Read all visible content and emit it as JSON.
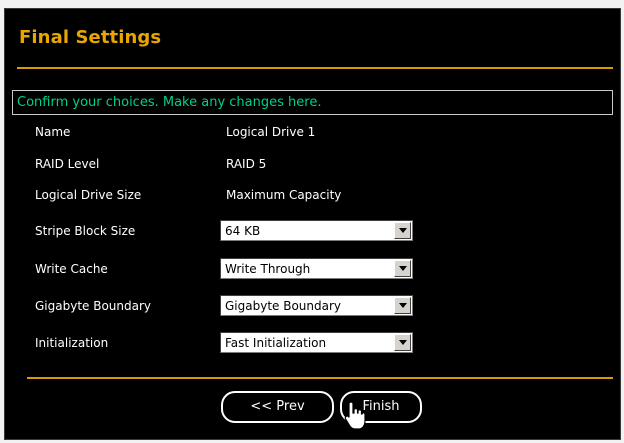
{
  "header": {
    "title": "Final Settings"
  },
  "confirm_message": "Confirm your choices. Make any changes here.",
  "fields": {
    "name": {
      "label": "Name",
      "value": "Logical Drive 1"
    },
    "raid_level": {
      "label": "RAID Level",
      "value": "RAID 5"
    },
    "drive_size": {
      "label": "Logical Drive Size",
      "value": "Maximum Capacity"
    },
    "stripe_block_size": {
      "label": "Stripe Block Size",
      "selected": "64 KB"
    },
    "write_cache": {
      "label": "Write Cache",
      "selected": "Write Through"
    },
    "gigabyte_boundary": {
      "label": "Gigabyte Boundary",
      "selected": "Gigabyte Boundary"
    },
    "initialization": {
      "label": "Initialization",
      "selected": "Fast Initialization"
    }
  },
  "buttons": {
    "prev": "<< Prev",
    "finish": "Finish"
  },
  "icons": {
    "select_arrow": "chevron-down-icon",
    "cursor": "hand-pointer-icon"
  },
  "colors": {
    "background": "#000000",
    "accent": "#e9a600",
    "confirm_text": "#00d08a"
  }
}
